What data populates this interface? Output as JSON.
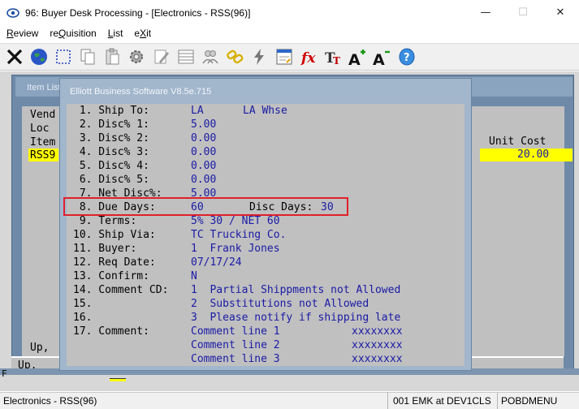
{
  "window": {
    "title": "96: Buyer Desk Processing - [Electronics - RSS(96)]",
    "minimize": "—",
    "maximize": "☐",
    "close": "✕"
  },
  "menu": [
    {
      "pre": "",
      "key": "R",
      "post": "eview"
    },
    {
      "pre": "re",
      "key": "Q",
      "post": "uisition"
    },
    {
      "pre": "",
      "key": "L",
      "post": "ist"
    },
    {
      "pre": "e",
      "key": "X",
      "post": "it"
    }
  ],
  "toolbar_icons": [
    "close-x-icon",
    "globe-icon",
    "select-box-icon",
    "copy-icon",
    "paste-icon",
    "settings-icon",
    "edit-icon",
    "table-icon",
    "users-icon",
    "chain-link-icon",
    "lightning-icon",
    "form-icon",
    "function-icon",
    "font-type-icon",
    "font-increase-icon",
    "font-decrease-icon",
    "help-icon"
  ],
  "back_window": {
    "title": "Item List",
    "lines": [
      "Vend",
      "Loc",
      "Item"
    ],
    "selected_code": "RSS9",
    "unit_cost_header": "Unit Cost",
    "unit_cost_value": "20.00",
    "up_label_1": "Up,",
    "up_label_2": "Up,",
    "side_label": "F"
  },
  "dialog": {
    "title": "Elliott Business Software V8.5e.715",
    "rows": [
      {
        "label": " 1. Ship To:",
        "v1": "LA",
        "v2": "LA Whse"
      },
      {
        "label": " 2. Disc% 1:",
        "v1": "5.00",
        "v2": ""
      },
      {
        "label": " 3. Disc% 2:",
        "v1": "0.00",
        "v2": ""
      },
      {
        "label": " 4. Disc% 3:",
        "v1": "0.00",
        "v2": ""
      },
      {
        "label": " 5. Disc% 4:",
        "v1": "0.00",
        "v2": ""
      },
      {
        "label": " 6. Disc% 5:",
        "v1": "0.00",
        "v2": ""
      },
      {
        "label": " 7. Net Disc%:",
        "v1": "5.00",
        "v2": ""
      },
      {
        "label": " 8. Due Days:",
        "v1": "60",
        "v2": ""
      },
      {
        "label": " 9. Terms:",
        "v1": "5% 30 / NET 60",
        "v2": ""
      },
      {
        "label": "10. Ship Via:",
        "v1": "TC Trucking Co.",
        "v2": ""
      },
      {
        "label": "11. Buyer:",
        "v1": "1  Frank Jones",
        "v2": ""
      },
      {
        "label": "12. Req Date:",
        "v1": "07/17/24",
        "v2": ""
      },
      {
        "label": "13. Confirm:",
        "v1": "N",
        "v2": ""
      },
      {
        "label": "14. Comment CD:",
        "v1": "1  Partial Shippments not Allowed",
        "v2": ""
      },
      {
        "label": "15.",
        "v1": "2  Substitutions not Allowed",
        "v2": ""
      },
      {
        "label": "16.",
        "v1": "3  Please notify if shipping late",
        "v2": ""
      },
      {
        "label": "17. Comment:",
        "v1": "Comment line 1",
        "v2": "xxxxxxxx"
      },
      {
        "label": "",
        "v1": "Comment line 2",
        "v2": "xxxxxxxx"
      },
      {
        "label": "",
        "v1": "Comment line 3",
        "v2": "xxxxxxxx"
      }
    ],
    "disc_days_label": "Disc Days:",
    "disc_days_value": "30"
  },
  "status": {
    "company": "Electronics - RSS(96)",
    "session": "001 EMK at DEV1CLS",
    "menu": "POBDMENU"
  }
}
